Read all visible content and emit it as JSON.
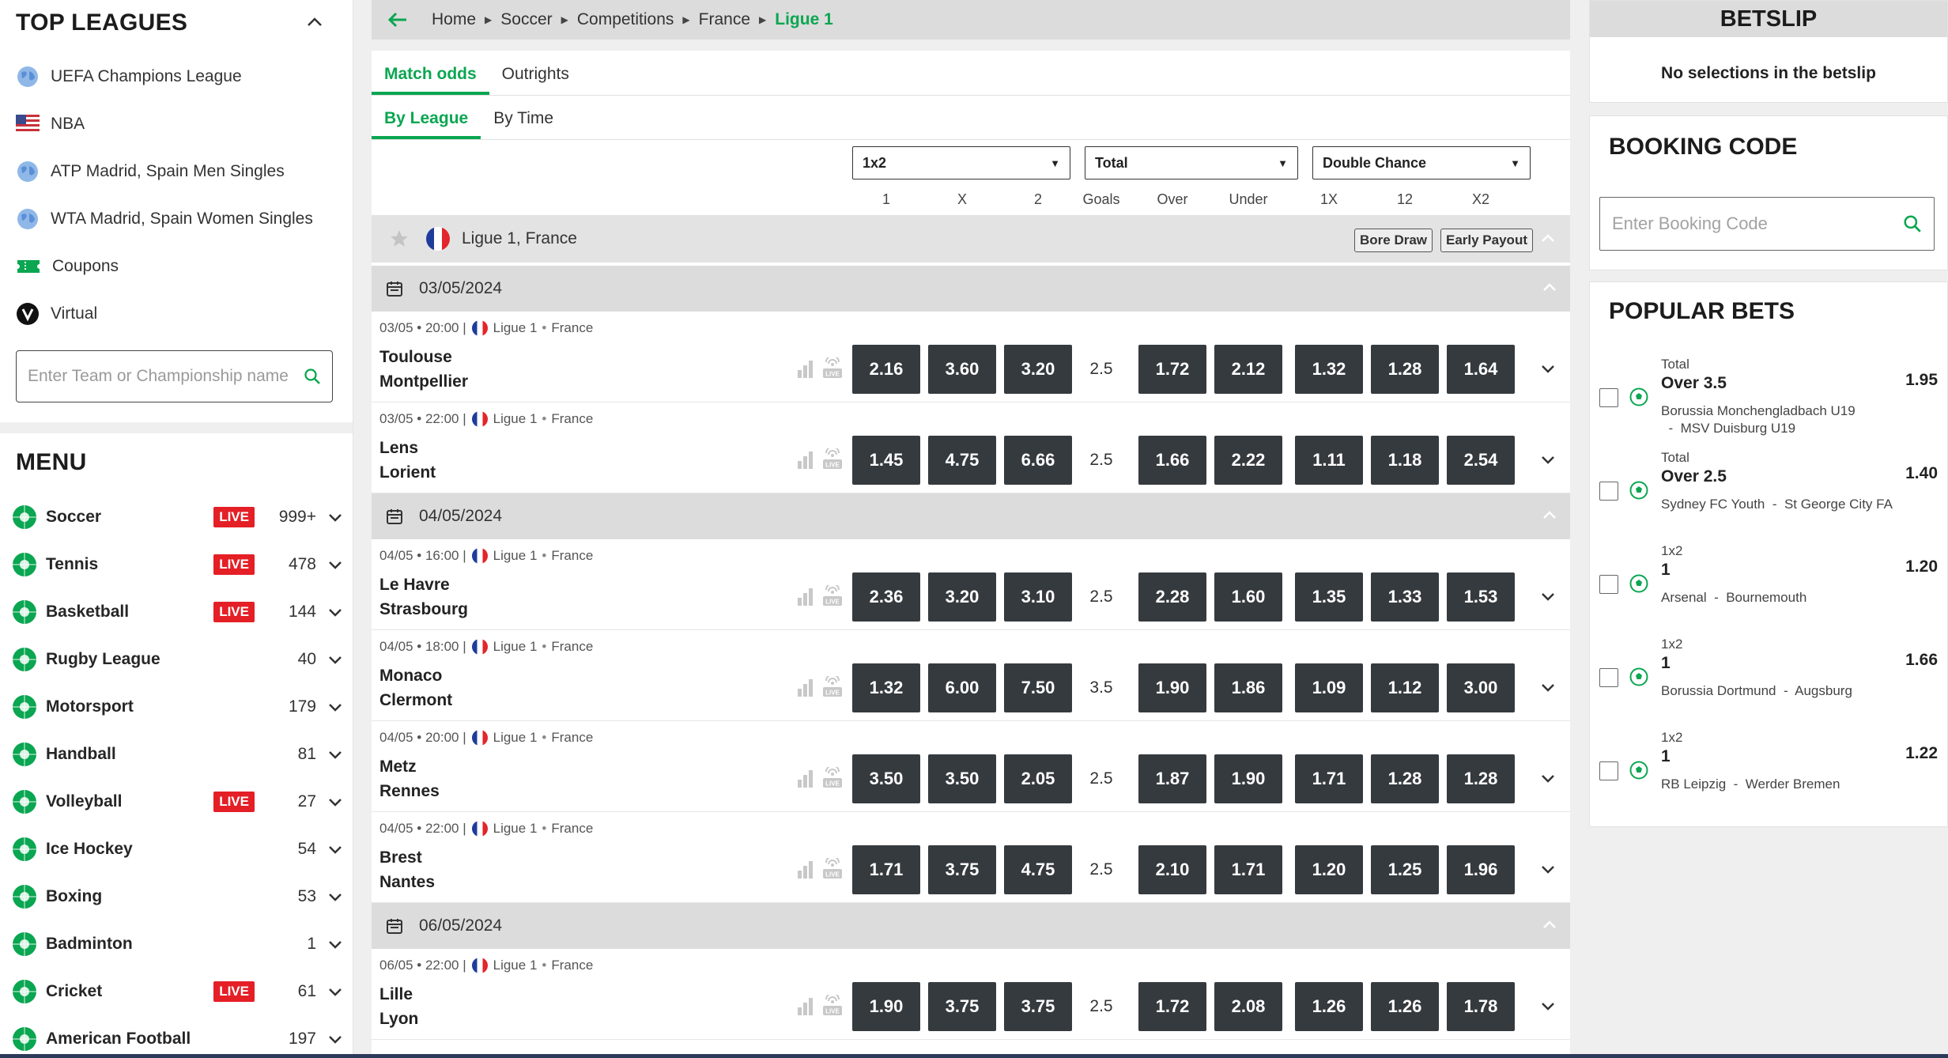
{
  "colors": {
    "accent": "#0aa651",
    "live": "#e41f26",
    "odd_bg": "#353a3e",
    "header_bg": "#dcdcdc"
  },
  "top_leagues": {
    "title": "TOP LEAGUES",
    "items": [
      {
        "label": "UEFA Champions League",
        "icon": "globe-icon"
      },
      {
        "label": "NBA",
        "icon": "us-flag-icon"
      },
      {
        "label": "ATP Madrid, Spain Men Singles",
        "icon": "globe-icon"
      },
      {
        "label": "WTA Madrid, Spain Women Singles",
        "icon": "globe-icon"
      },
      {
        "label": "Coupons",
        "icon": "coupon-icon"
      },
      {
        "label": "Virtual",
        "icon": "virtual-icon"
      }
    ],
    "search_placeholder": "Enter Team or Championship name"
  },
  "menu": {
    "title": "MENU",
    "live_label": "LIVE",
    "sports": [
      {
        "name": "Soccer",
        "live": true,
        "count": "999+"
      },
      {
        "name": "Tennis",
        "live": true,
        "count": "478"
      },
      {
        "name": "Basketball",
        "live": true,
        "count": "144"
      },
      {
        "name": "Rugby League",
        "live": false,
        "count": "40"
      },
      {
        "name": "Motorsport",
        "live": false,
        "count": "179"
      },
      {
        "name": "Handball",
        "live": false,
        "count": "81"
      },
      {
        "name": "Volleyball",
        "live": true,
        "count": "27"
      },
      {
        "name": "Ice Hockey",
        "live": false,
        "count": "54"
      },
      {
        "name": "Boxing",
        "live": false,
        "count": "53"
      },
      {
        "name": "Badminton",
        "live": false,
        "count": "1"
      },
      {
        "name": "Cricket",
        "live": true,
        "count": "61"
      },
      {
        "name": "American Football",
        "live": false,
        "count": "197"
      }
    ]
  },
  "breadcrumb": [
    "Home",
    "Soccer",
    "Competitions",
    "France",
    "Ligue 1"
  ],
  "tabs": {
    "primary": [
      "Match odds",
      "Outrights"
    ],
    "secondary": [
      "By League",
      "By Time"
    ]
  },
  "markets": {
    "selects": [
      "1x2",
      "Total",
      "Double Chance"
    ],
    "columns": [
      "1",
      "X",
      "2",
      "Goals",
      "Over",
      "Under",
      "1X",
      "12",
      "X2"
    ]
  },
  "league": {
    "name": "Ligue 1, France",
    "pills": [
      "Bore Draw",
      "Early Payout"
    ]
  },
  "dates": [
    "03/05/2024",
    "04/05/2024",
    "06/05/2024"
  ],
  "matches": [
    {
      "meta": "03/05 • 20:00 |",
      "league": "Ligue 1",
      "country": "France",
      "home": "Toulouse",
      "away": "Montpellier",
      "odds": [
        "2.16",
        "3.60",
        "3.20"
      ],
      "goals": "2.5",
      "ou": [
        "1.72",
        "2.12"
      ],
      "dc": [
        "1.32",
        "1.28",
        "1.64"
      ]
    },
    {
      "meta": "03/05 • 22:00 |",
      "league": "Ligue 1",
      "country": "France",
      "home": "Lens",
      "away": "Lorient",
      "odds": [
        "1.45",
        "4.75",
        "6.66"
      ],
      "goals": "2.5",
      "ou": [
        "1.66",
        "2.22"
      ],
      "dc": [
        "1.11",
        "1.18",
        "2.54"
      ]
    },
    {
      "meta": "04/05 • 16:00 |",
      "league": "Ligue 1",
      "country": "France",
      "home": "Le Havre",
      "away": "Strasbourg",
      "odds": [
        "2.36",
        "3.20",
        "3.10"
      ],
      "goals": "2.5",
      "ou": [
        "2.28",
        "1.60"
      ],
      "dc": [
        "1.35",
        "1.33",
        "1.53"
      ]
    },
    {
      "meta": "04/05 • 18:00 |",
      "league": "Ligue 1",
      "country": "France",
      "home": "Monaco",
      "away": "Clermont",
      "odds": [
        "1.32",
        "6.00",
        "7.50"
      ],
      "goals": "3.5",
      "ou": [
        "1.90",
        "1.86"
      ],
      "dc": [
        "1.09",
        "1.12",
        "3.00"
      ]
    },
    {
      "meta": "04/05 • 20:00 |",
      "league": "Ligue 1",
      "country": "France",
      "home": "Metz",
      "away": "Rennes",
      "odds": [
        "3.50",
        "3.50",
        "2.05"
      ],
      "goals": "2.5",
      "ou": [
        "1.87",
        "1.90"
      ],
      "dc": [
        "1.71",
        "1.28",
        "1.28"
      ]
    },
    {
      "meta": "04/05 • 22:00 |",
      "league": "Ligue 1",
      "country": "France",
      "home": "Brest",
      "away": "Nantes",
      "odds": [
        "1.71",
        "3.75",
        "4.75"
      ],
      "goals": "2.5",
      "ou": [
        "2.10",
        "1.71"
      ],
      "dc": [
        "1.20",
        "1.25",
        "1.96"
      ]
    },
    {
      "meta": "06/05 • 22:00 |",
      "league": "Ligue 1",
      "country": "France",
      "home": "Lille",
      "away": "Lyon",
      "odds": [
        "1.90",
        "3.75",
        "3.75"
      ],
      "goals": "2.5",
      "ou": [
        "1.72",
        "2.08"
      ],
      "dc": [
        "1.26",
        "1.26",
        "1.78"
      ]
    }
  ],
  "betslip": {
    "title": "BETSLIP",
    "empty": "No selections in the betslip"
  },
  "booking": {
    "title": "BOOKING CODE",
    "placeholder": "Enter Booking Code"
  },
  "popular": {
    "title": "POPULAR BETS",
    "bets": [
      {
        "market": "Total",
        "selection": "Over 3.5",
        "price": "1.95",
        "home": "Borussia Monchengladbach U19",
        "away": "MSV Duisburg U19"
      },
      {
        "market": "Total",
        "selection": "Over 2.5",
        "price": "1.40",
        "home": "Sydney FC Youth",
        "away": "St George City FA"
      },
      {
        "market": "1x2",
        "selection": "1",
        "price": "1.20",
        "home": "Arsenal",
        "away": "Bournemouth"
      },
      {
        "market": "1x2",
        "selection": "1",
        "price": "1.66",
        "home": "Borussia Dortmund",
        "away": "Augsburg"
      },
      {
        "market": "1x2",
        "selection": "1",
        "price": "1.22",
        "home": "RB Leipzig",
        "away": "Werder Bremen"
      }
    ]
  }
}
